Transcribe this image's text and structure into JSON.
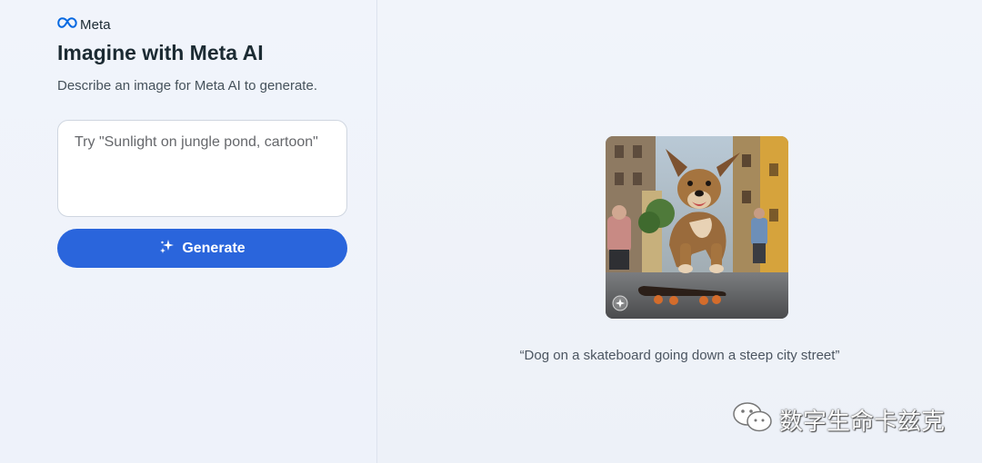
{
  "brand": {
    "name": "Meta",
    "icon": "meta-infinity-logo"
  },
  "header": {
    "title": "Imagine with Meta AI",
    "subtitle": "Describe an image for Meta AI to generate."
  },
  "prompt": {
    "value": "",
    "placeholder": "Try \"Sunlight on jungle pond, cartoon\""
  },
  "generate_button": {
    "label": "Generate",
    "icon": "sparkle-icon",
    "color": "#2a65dc"
  },
  "example": {
    "image_alt": "dog-skateboard-image",
    "badge_icon": "imagine-sparkle-badge-icon",
    "caption": "“Dog on a skateboard going down a steep city street”"
  },
  "watermark": {
    "text": "数字生命卡兹克",
    "icon": "wechat-icon"
  }
}
